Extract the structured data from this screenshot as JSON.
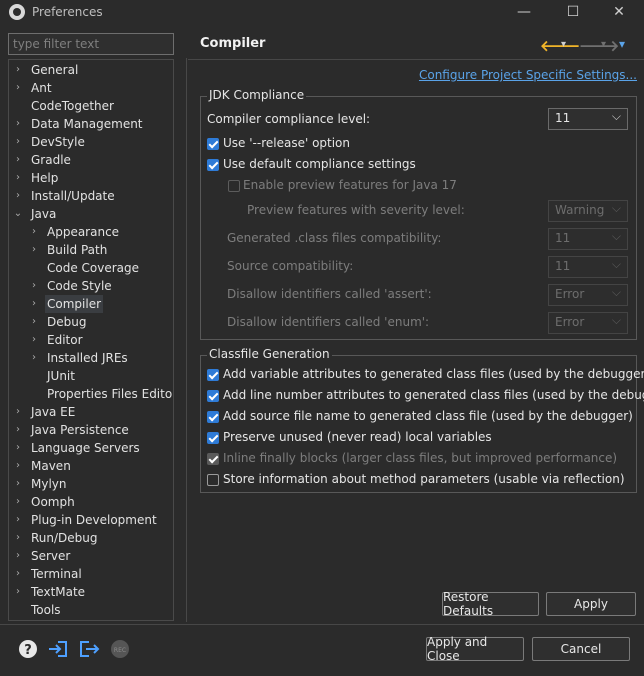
{
  "window": {
    "title": "Preferences",
    "minimize": "—",
    "maximize": "☐",
    "close": "✕"
  },
  "filter": {
    "placeholder": "type filter text"
  },
  "tree": [
    {
      "label": "General",
      "arrow": "›"
    },
    {
      "label": "Ant",
      "arrow": "›"
    },
    {
      "label": "CodeTogether",
      "arrow": ""
    },
    {
      "label": "Data Management",
      "arrow": "›"
    },
    {
      "label": "DevStyle",
      "arrow": "›"
    },
    {
      "label": "Gradle",
      "arrow": "›"
    },
    {
      "label": "Help",
      "arrow": "›"
    },
    {
      "label": "Install/Update",
      "arrow": "›"
    },
    {
      "label": "Java",
      "arrow": "⌄"
    },
    {
      "label": "Appearance",
      "arrow": "›"
    },
    {
      "label": "Build Path",
      "arrow": "›"
    },
    {
      "label": "Code Coverage",
      "arrow": ""
    },
    {
      "label": "Code Style",
      "arrow": "›"
    },
    {
      "label": "Compiler",
      "arrow": "›"
    },
    {
      "label": "Debug",
      "arrow": "›"
    },
    {
      "label": "Editor",
      "arrow": "›"
    },
    {
      "label": "Installed JREs",
      "arrow": "›"
    },
    {
      "label": "JUnit",
      "arrow": ""
    },
    {
      "label": "Properties Files Editor",
      "arrow": ""
    },
    {
      "label": "Java EE",
      "arrow": "›"
    },
    {
      "label": "Java Persistence",
      "arrow": "›"
    },
    {
      "label": "Language Servers",
      "arrow": "›"
    },
    {
      "label": "Maven",
      "arrow": "›"
    },
    {
      "label": "Mylyn",
      "arrow": "›"
    },
    {
      "label": "Oomph",
      "arrow": "›"
    },
    {
      "label": "Plug-in Development",
      "arrow": "›"
    },
    {
      "label": "Run/Debug",
      "arrow": "›"
    },
    {
      "label": "Server",
      "arrow": "›"
    },
    {
      "label": "Terminal",
      "arrow": "›"
    },
    {
      "label": "TextMate",
      "arrow": "›"
    },
    {
      "label": "Tools",
      "arrow": ""
    }
  ],
  "page": {
    "title": "Compiler",
    "back": "🡐",
    "back_menu": "▾",
    "forward": "🡒",
    "forward_menu": "▾",
    "view_menu": "▾",
    "link": "Configure Project Specific Settings..."
  },
  "jdk": {
    "title": "JDK Compliance",
    "level_label": "Compiler compliance level:",
    "level_value": "11",
    "use_release": "Use '--release' option",
    "use_default": "Use default compliance settings",
    "enable_preview": "Enable preview features for Java 17",
    "preview_severity_label": "Preview features with severity level:",
    "preview_severity_value": "Warning",
    "generated_label": "Generated .class files compatibility:",
    "generated_value": "11",
    "source_label": "Source compatibility:",
    "source_value": "11",
    "assert_label": "Disallow identifiers called 'assert':",
    "assert_value": "Error",
    "enum_label": "Disallow identifiers called 'enum':",
    "enum_value": "Error"
  },
  "classfile": {
    "title": "Classfile Generation",
    "items": [
      {
        "label": "Add variable attributes to generated class files (used by the debugger)",
        "checked": true,
        "disabled": false
      },
      {
        "label": "Add line number attributes to generated class files (used by the debugger)",
        "checked": true,
        "disabled": false
      },
      {
        "label": "Add source file name to generated class file (used by the debugger)",
        "checked": true,
        "disabled": false
      },
      {
        "label": "Preserve unused (never read) local variables",
        "checked": true,
        "disabled": false
      },
      {
        "label": "Inline finally blocks (larger class files, but improved performance)",
        "checked": true,
        "disabled": true
      },
      {
        "label": "Store information about method parameters (usable via reflection)",
        "checked": false,
        "disabled": false
      }
    ]
  },
  "buttons": {
    "restore": "Restore Defaults",
    "apply": "Apply",
    "apply_close": "Apply and Close",
    "cancel": "Cancel"
  },
  "footer_icons": [
    "help-icon",
    "import-icon",
    "export-icon",
    "record-icon"
  ],
  "colors": {
    "accent": "#2e7bd7",
    "link": "#5aa3e8",
    "back_arrow": "#f0b429"
  }
}
